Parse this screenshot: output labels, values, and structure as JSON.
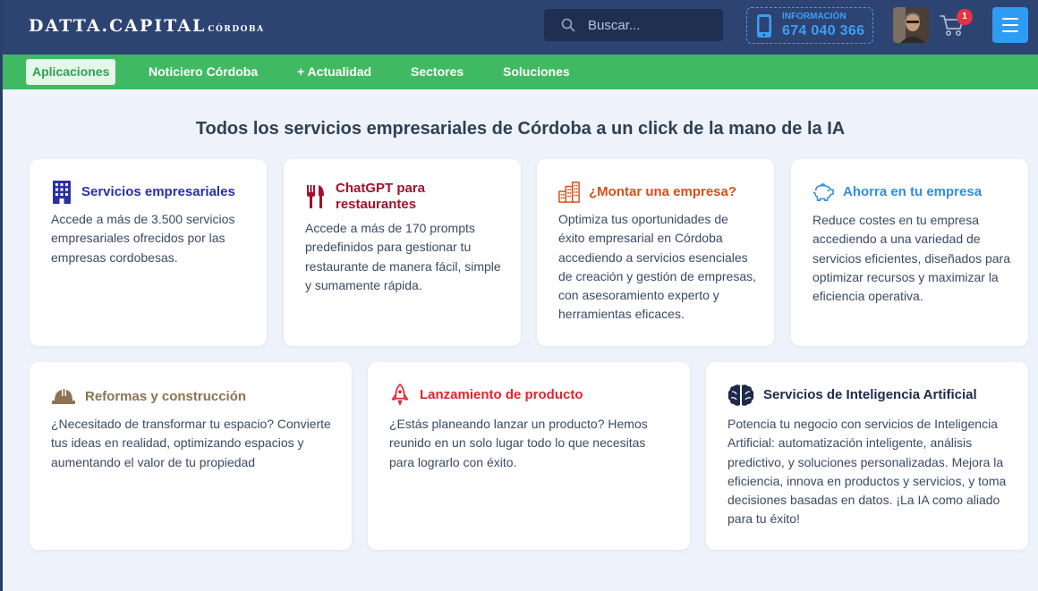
{
  "header": {
    "logo": "DATTA.CAPITAL",
    "logo_sub": "CÓRDOBA",
    "search_placeholder": "Buscar...",
    "info_label": "INFORMACIÓN",
    "info_phone": "674 040 366",
    "cart_count": "1"
  },
  "nav": {
    "items": [
      "Aplicaciones",
      "Noticiero Córdoba",
      "+ Actualidad",
      "Sectores",
      "Soluciones"
    ],
    "active": "Aplicaciones"
  },
  "main": {
    "title": "Todos los servicios empresariales de Córdoba a un click de la mano de la IA",
    "cards": [
      {
        "icon": "building-icon",
        "color": "#2a2fa8",
        "title": "Servicios empresariales",
        "text": "Accede a más de 3.500 servicios empresariales ofrecidos por las empresas cordobesas."
      },
      {
        "icon": "utensils-icon",
        "color": "#a3102c",
        "title": "ChatGPT para restaurantes",
        "text": "Accede a más de 170 prompts predefinidos para gestionar tu restaurante de manera fácil, simple y sumamente rápida."
      },
      {
        "icon": "city-icon",
        "color": "#d4501b",
        "title": "¿Montar una empresa?",
        "text": "Optimiza tus oportunidades de éxito empresarial en Córdoba accediendo a servicios esenciales de creación y gestión de empresas, con asesoramiento experto y herramientas eficaces."
      },
      {
        "icon": "piggy-bank-icon",
        "color": "#2f8ee0",
        "title": "Ahorra en tu empresa",
        "text": "Reduce costes en tu empresa accediendo a una variedad de servicios eficientes, diseñados para optimizar recursos y maximizar la eficiencia operativa."
      },
      {
        "icon": "hard-hat-icon",
        "color": "#8c7350",
        "title": "Reformas y construcción",
        "text": "¿Necesitado de transformar tu espacio? Convierte tus ideas en realidad, optimizando espacios y aumentando el valor de tu propiedad"
      },
      {
        "icon": "rocket-icon",
        "color": "#e0252f",
        "title": "Lanzamiento de producto",
        "text": "¿Estás planeando lanzar un producto? Hemos reunido en un solo lugar todo lo que necesitas para lograrlo con éxito."
      },
      {
        "icon": "brain-icon",
        "color": "#1e2a4a",
        "title": "Servicios de Inteligencia Artificial",
        "text": "Potencia tu negocio con servicios de Inteligencia Artificial: automatización inteligente, análisis predictivo, y soluciones personalizadas. Mejora la eficiencia, innova en productos y servicios, y toma decisiones basadas en datos. ¡La IA como aliado para tu éxito!"
      }
    ]
  }
}
